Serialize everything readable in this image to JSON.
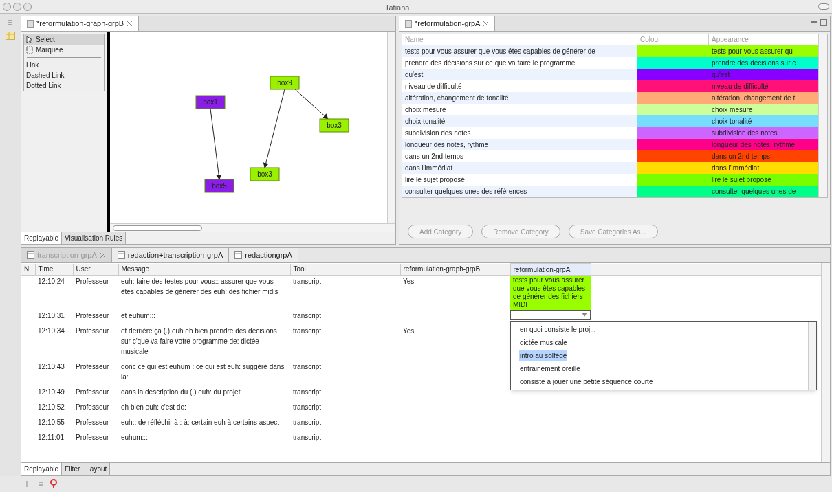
{
  "window": {
    "title": "Tatiana"
  },
  "graph_editor": {
    "tab": "*reformulation-graph-grpB",
    "palette": [
      {
        "label": "Select",
        "kind": "tool",
        "selected": true
      },
      {
        "label": "Marquee",
        "kind": "tool",
        "selected": false
      },
      {
        "label": "Link",
        "kind": "link",
        "selected": false
      },
      {
        "label": "Dashed Link",
        "kind": "link",
        "selected": false
      },
      {
        "label": "Dotted Link",
        "kind": "link",
        "selected": false
      }
    ],
    "nodes": [
      {
        "label": "box1",
        "color": "#8a1ee6"
      },
      {
        "label": "box5",
        "color": "#8a1ee6"
      },
      {
        "label": "box9",
        "color": "#99f000"
      },
      {
        "label": "box3",
        "color": "#99f000"
      },
      {
        "label": "box3",
        "color": "#99f000"
      }
    ],
    "bottom_tabs": [
      {
        "label": "Replayable",
        "selected": true
      },
      {
        "label": "Visualisation Rules",
        "selected": false
      }
    ]
  },
  "categories": {
    "tab": "*reformulation-grpA",
    "columns": [
      "Name",
      "Colour",
      "Appearance"
    ],
    "rows": [
      {
        "name": "tests pour vous assurer que vous êtes capables de générer de",
        "color": "#99ff00",
        "appearance": "tests pour vous assurer qu"
      },
      {
        "name": "prendre des décisions sur ce que va faire le programme",
        "color": "#00ffcc",
        "appearance": "prendre des décisions sur c"
      },
      {
        "name": "qu'est",
        "color": "#8800ff",
        "appearance": "qu'est"
      },
      {
        "name": "niveau de difficulté",
        "color": "#ff1177",
        "appearance": "niveau de difficulté"
      },
      {
        "name": "altération, changement de tonalité",
        "color": "#ffaa77",
        "appearance": "altération, changement de t"
      },
      {
        "name": "choix mesure",
        "color": "#ccff99",
        "appearance": "choix mesure"
      },
      {
        "name": "choix tonalité",
        "color": "#77ddff",
        "appearance": "choix tonalité"
      },
      {
        "name": "subdivision des notes",
        "color": "#cc66ff",
        "appearance": "subdivision des notes"
      },
      {
        "name": "longueur des notes, rythme",
        "color": "#ff0088",
        "appearance": "longueur des notes, rythme"
      },
      {
        "name": "dans un 2nd temps",
        "color": "#ff4400",
        "appearance": "dans un 2nd temps"
      },
      {
        "name": "dans l'immédiat",
        "color": "#ffdd00",
        "appearance": "dans l'immédiat"
      },
      {
        "name": "lire le sujet proposé",
        "color": "#77ff00",
        "appearance": "lire le sujet proposé"
      },
      {
        "name": "consulter quelques unes des références",
        "color": "#00ff88",
        "appearance": "consulter quelques unes de"
      }
    ],
    "buttons": [
      "Add Category",
      "Remove Category",
      "Save Categories As..."
    ]
  },
  "log": {
    "tabs": [
      {
        "label": "transcription-grpA",
        "selected": true
      },
      {
        "label": "redaction+transcription-grpA",
        "selected": false
      },
      {
        "label": "redactiongrpA",
        "selected": false
      }
    ],
    "columns": [
      "N",
      "Time",
      "User",
      "Message",
      "Tool",
      "reformulation-graph-grpB",
      "reformulation-grpA"
    ],
    "rows": [
      {
        "time": "12:10:24",
        "user": "Professeur",
        "message": "euh: faire des testes pour vous:: assurer que vous êtes capables de générer des euh: des fichier midis",
        "tool": "transcript",
        "graph_grpB": "Yes",
        "grpA": {
          "kind": "category",
          "text": "tests pour vous assurer que vous êtes capables de générer des fichiers MIDI",
          "color": "#99ff00"
        }
      },
      {
        "time": "12:10:31",
        "user": "Professeur",
        "message": "et euhum:::",
        "tool": "transcript",
        "grpA": {
          "kind": "combo"
        }
      },
      {
        "time": "12:10:34",
        "user": "Professeur",
        "message": "et derrière ça (.) euh eh bien prendre des décisions sur c'que va faire votre programme de: dictée musicale",
        "tool": "transcript",
        "graph_grpB": "Yes"
      },
      {
        "time": "12:10:43",
        "user": "Professeur",
        "message": "donc ce qui est euhum : ce qui est euh: suggéré dans la:",
        "tool": "transcript"
      },
      {
        "time": "12:10:49",
        "user": "Professeur",
        "message": "dans la description du (.) euh: du projet",
        "tool": "transcript"
      },
      {
        "time": "12:10:52",
        "user": "Professeur",
        "message": "eh bien euh: c'est de:",
        "tool": "transcript"
      },
      {
        "time": "12:10:55",
        "user": "Professeur",
        "message": "euh:: de réfléchir à : à: certain euh à certains aspect",
        "tool": "transcript"
      },
      {
        "time": "12:11:01",
        "user": "Professeur",
        "message": "euhum:::",
        "tool": "transcript"
      }
    ],
    "dropdown": [
      {
        "label": "en quoi consiste le proj...",
        "selected": false
      },
      {
        "label": "dictée musicale",
        "selected": false
      },
      {
        "label": "intro au solfège",
        "selected": true
      },
      {
        "label": "entrainement oreille",
        "selected": false
      },
      {
        "label": "consiste à jouer une petite séquence courte",
        "selected": false
      }
    ],
    "bottom_tabs": [
      {
        "label": "Replayable",
        "selected": true
      },
      {
        "label": "Filter",
        "selected": false
      },
      {
        "label": "Layout",
        "selected": false
      }
    ]
  }
}
